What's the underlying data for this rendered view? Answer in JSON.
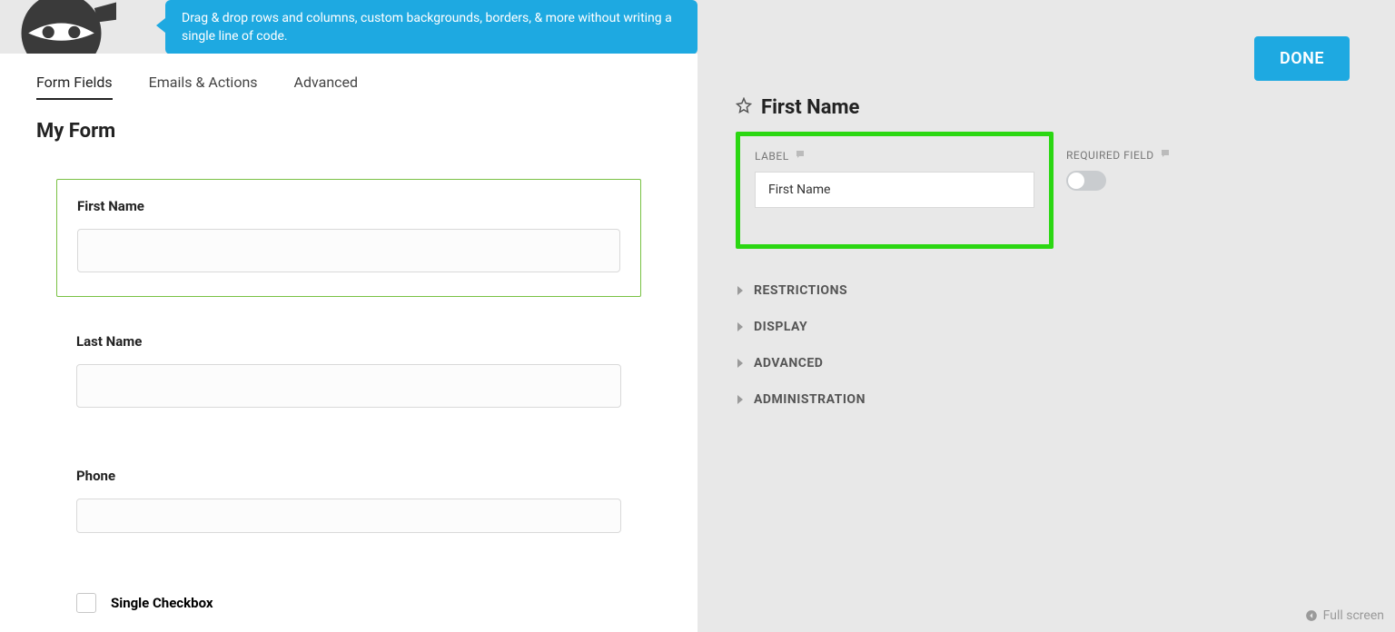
{
  "tooltip_text": "Drag & drop rows and columns, custom backgrounds, borders, & more without writing a single line of code.",
  "done_label": "DONE",
  "tabs": {
    "form_fields": "Form Fields",
    "emails_actions": "Emails & Actions",
    "advanced": "Advanced"
  },
  "form_title": "My Form",
  "fields": {
    "first_name_label": "First Name",
    "last_name_label": "Last Name",
    "phone_label": "Phone",
    "checkbox_label": "Single Checkbox"
  },
  "sidebar": {
    "title": "First Name",
    "label_caption": "LABEL",
    "label_value": "First Name",
    "required_caption": "REQUIRED FIELD",
    "sections": {
      "restrictions": "RESTRICTIONS",
      "display": "DISPLAY",
      "advanced": "ADVANCED",
      "administration": "ADMINISTRATION"
    }
  },
  "fullscreen_label": "Full screen"
}
